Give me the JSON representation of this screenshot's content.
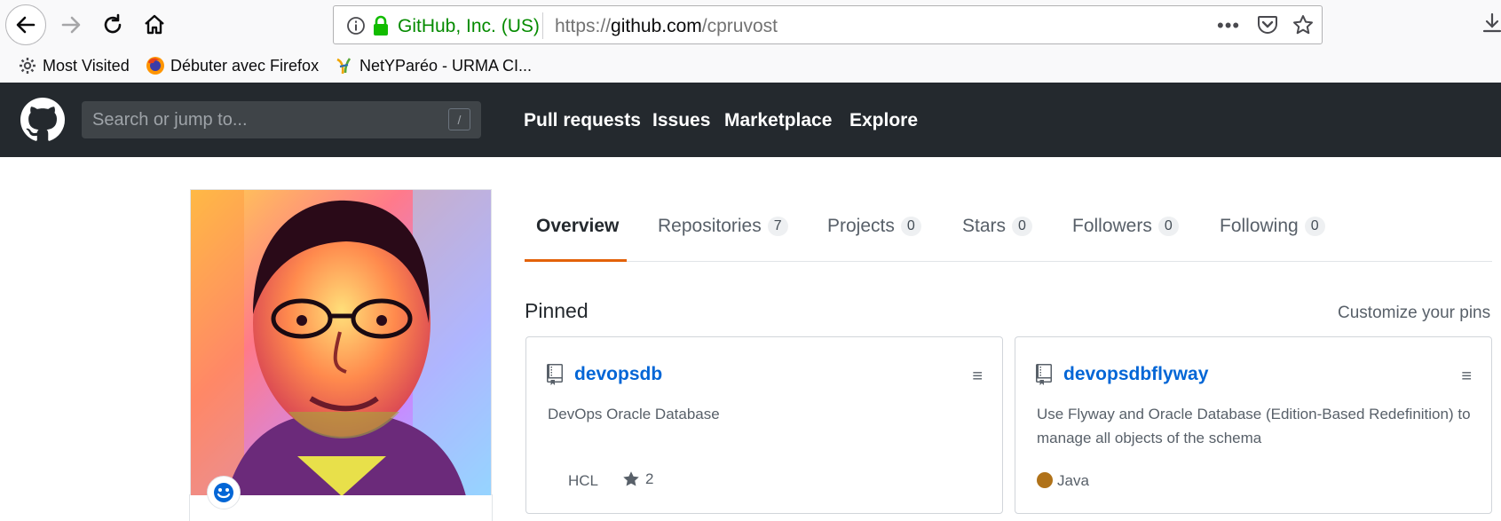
{
  "browser": {
    "identity": "GitHub, Inc. (US)",
    "url_prefix": "https://",
    "url_host": "github.com",
    "url_path": "/cpruvost",
    "more_label": "•••",
    "bookmarks": [
      {
        "label": "Most Visited",
        "icon": "gear-icon"
      },
      {
        "label": "Débuter avec Firefox",
        "icon": "firefox-icon"
      },
      {
        "label": "NetYParéo - URMA CI...",
        "icon": "netypareo-icon"
      }
    ],
    "identity_color": "#058b00"
  },
  "github": {
    "search_placeholder": "Search or jump to...",
    "search_shortcut": "/",
    "nav": [
      "Pull requests",
      "Issues",
      "Marketplace",
      "Explore"
    ],
    "header_bg": "#24292e"
  },
  "profile": {
    "tabs": [
      {
        "label": "Overview",
        "count": null,
        "active": true
      },
      {
        "label": "Repositories",
        "count": "7"
      },
      {
        "label": "Projects",
        "count": "0"
      },
      {
        "label": "Stars",
        "count": "0"
      },
      {
        "label": "Followers",
        "count": "0"
      },
      {
        "label": "Following",
        "count": "0"
      }
    ],
    "pinned_title": "Pinned",
    "customize_label": "Customize your pins",
    "pinned": [
      {
        "name": "devopsdb",
        "description": "DevOps Oracle Database",
        "language": "HCL",
        "stars": "2"
      },
      {
        "name": "devopsdbflyway",
        "description": "Use Flyway and Oracle Database (Edition-Based Redefinition) to manage all objects of the schema",
        "language": "Java",
        "language_color": "#b07219"
      }
    ],
    "accent_color": "#e36209",
    "link_color": "#0366d6"
  }
}
